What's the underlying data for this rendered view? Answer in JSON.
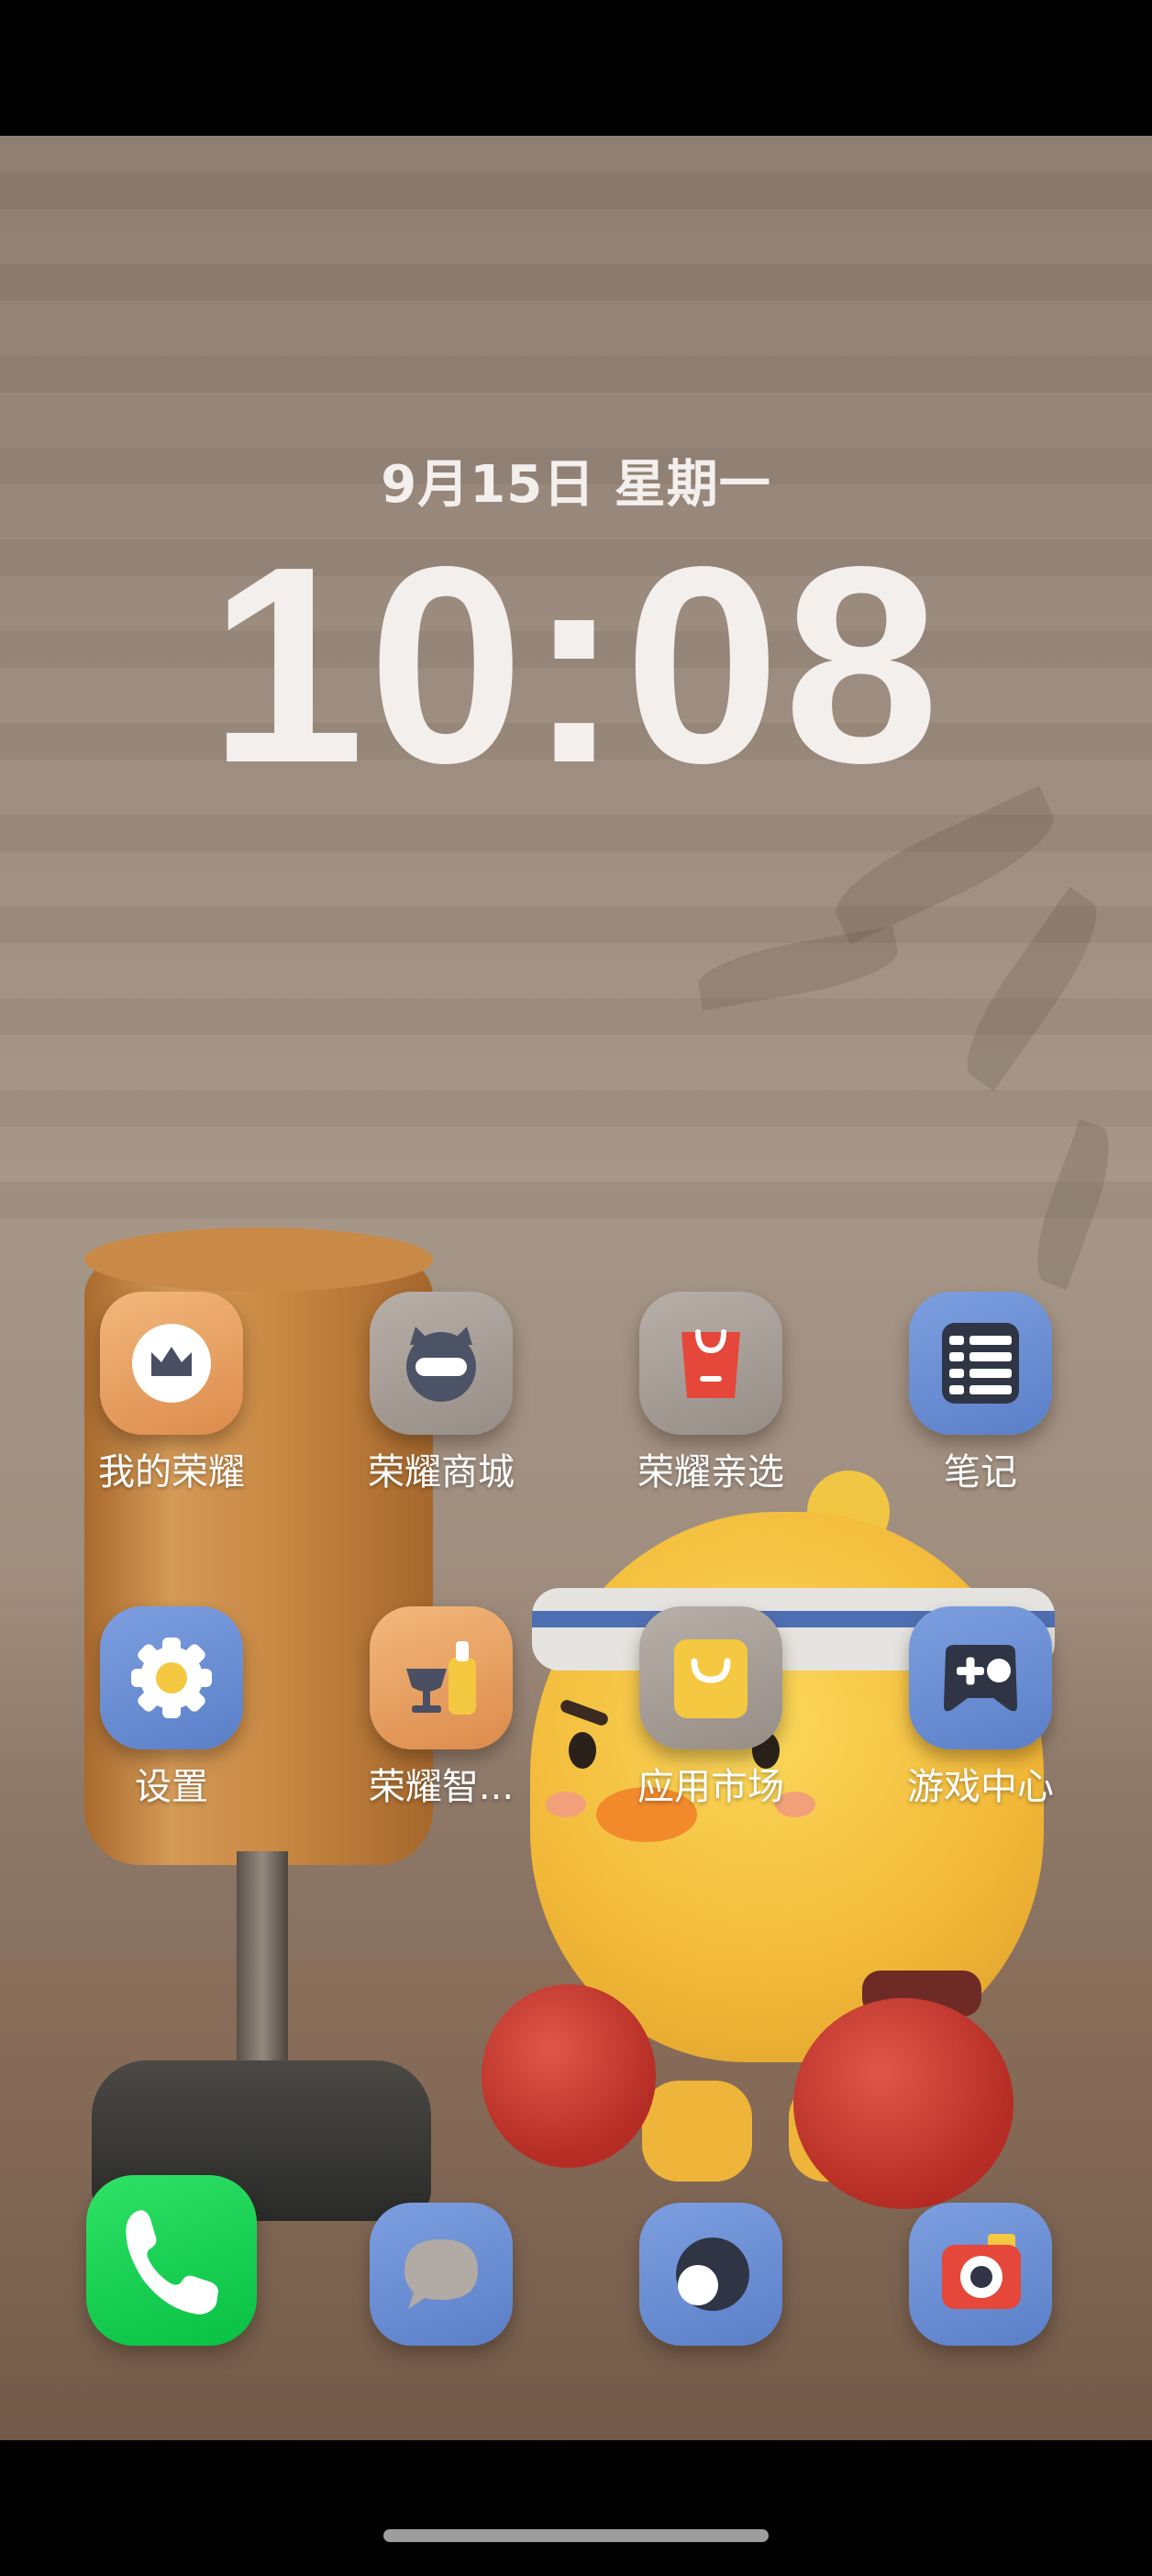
{
  "lockscreen": {
    "date": "9月15日 星期一",
    "time": "10:08"
  },
  "apps": [
    {
      "label": "我的荣耀",
      "icon": "crown-icon"
    },
    {
      "label": "荣耀商城",
      "icon": "mall-icon"
    },
    {
      "label": "荣耀亲选",
      "icon": "shopping-bag-icon"
    },
    {
      "label": "笔记",
      "icon": "notes-icon"
    },
    {
      "label": "设置",
      "icon": "gear-icon"
    },
    {
      "label": "荣耀智...",
      "icon": "smart-home-icon"
    },
    {
      "label": "应用市场",
      "icon": "app-market-icon"
    },
    {
      "label": "游戏中心",
      "icon": "gamepad-icon"
    }
  ],
  "dock": [
    {
      "icon": "phone-icon"
    },
    {
      "icon": "messages-icon"
    },
    {
      "icon": "browser-icon"
    },
    {
      "icon": "camera-icon"
    }
  ],
  "colors": {
    "orange_icon": "#e49a5c",
    "grey_icon": "#a69d97",
    "blue_icon": "#6a8ed6",
    "phone_green": "#17d04f",
    "red_accent": "#e5473a",
    "yellow_accent": "#f5c842"
  }
}
